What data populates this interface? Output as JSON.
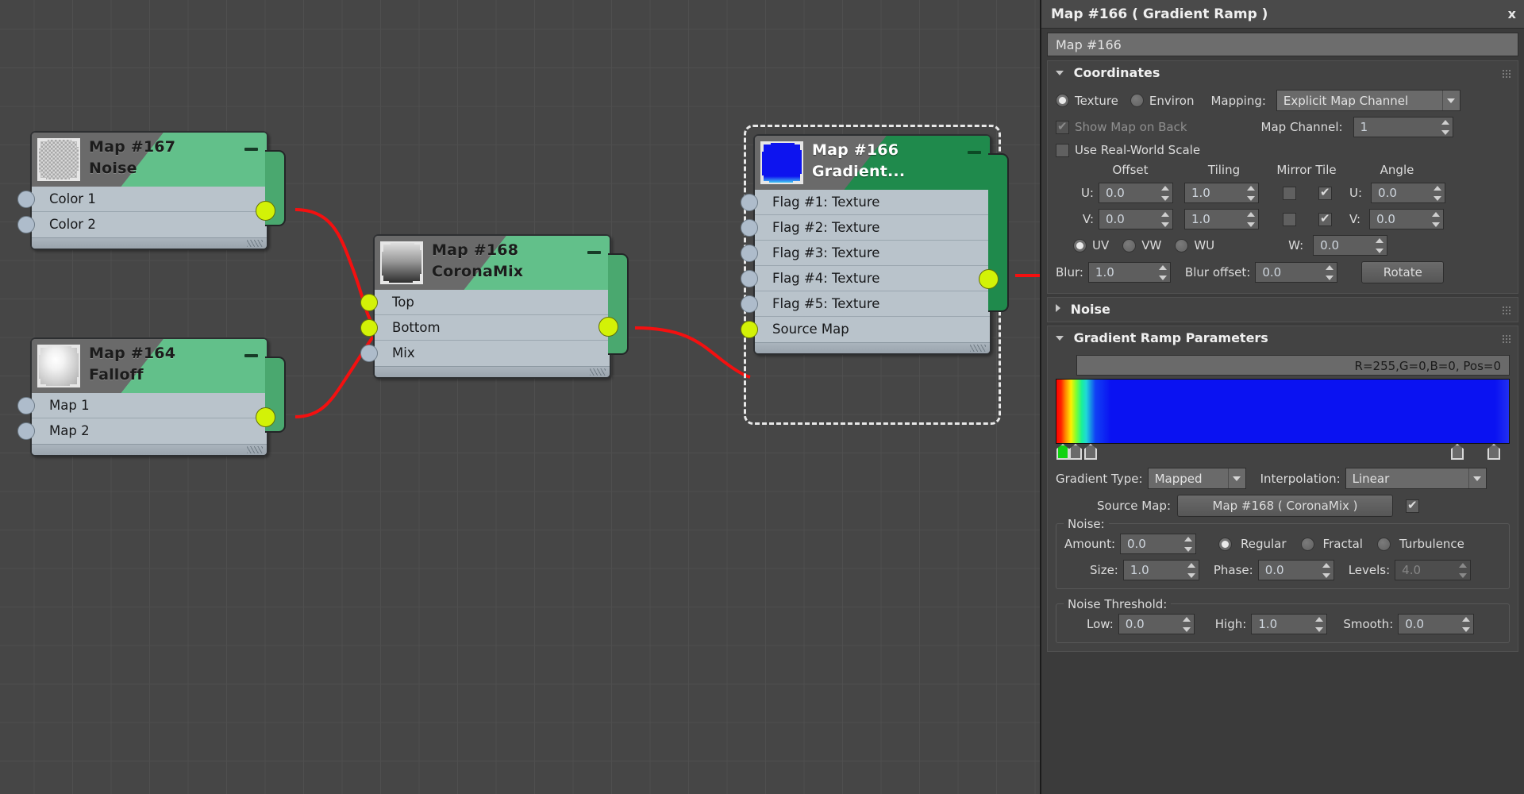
{
  "graph": {
    "nodes": [
      {
        "id": "noise",
        "map_id": "Map #167",
        "type": "Noise",
        "thumb": "noise-thumbnail",
        "selected": false,
        "ports": [
          {
            "label": "Color 1",
            "connected": false
          },
          {
            "label": "Color 2",
            "connected": false
          }
        ],
        "output_connected": true
      },
      {
        "id": "falloff",
        "map_id": "Map #164",
        "type": "Falloff",
        "thumb": "falloff-thumbnail",
        "selected": false,
        "ports": [
          {
            "label": "Map 1",
            "connected": false
          },
          {
            "label": "Map 2",
            "connected": false
          }
        ],
        "output_connected": true
      },
      {
        "id": "coronamix",
        "map_id": "Map #168",
        "type": "CoronaMix",
        "thumb": "coronamix-thumbnail",
        "selected": false,
        "ports": [
          {
            "label": "Top",
            "connected": true
          },
          {
            "label": "Bottom",
            "connected": true
          },
          {
            "label": "Mix",
            "connected": false
          }
        ],
        "output_connected": true
      },
      {
        "id": "gradient",
        "map_id": "Map #166",
        "type": "Gradient...",
        "thumb": "gradient-ramp-thumbnail",
        "selected": true,
        "ports": [
          {
            "label": "Flag #1: Texture",
            "connected": false
          },
          {
            "label": "Flag #2: Texture",
            "connected": false
          },
          {
            "label": "Flag #3: Texture",
            "connected": false
          },
          {
            "label": "Flag #4: Texture",
            "connected": false
          },
          {
            "label": "Flag #5: Texture",
            "connected": false
          },
          {
            "label": "Source Map",
            "connected": true
          }
        ],
        "output_connected": true
      }
    ],
    "wire_color": "#f41010"
  },
  "panel": {
    "title": "Map #166  ( Gradient Ramp )",
    "close_label": "x",
    "name_value": "Map #166",
    "coordinates": {
      "header": "Coordinates",
      "expanded": true,
      "texture_label": "Texture",
      "texture_selected": true,
      "environ_label": "Environ",
      "environ_selected": false,
      "mapping_label": "Mapping:",
      "mapping_value": "Explicit Map Channel",
      "show_map_on_back_label": "Show Map on Back",
      "show_map_on_back_checked": true,
      "map_channel_label": "Map Channel:",
      "map_channel_value": "1",
      "use_real_world_scale_label": "Use Real-World Scale",
      "use_real_world_scale_checked": false,
      "col_offset": "Offset",
      "col_tiling": "Tiling",
      "col_mirror_tile": "Mirror Tile",
      "col_angle": "Angle",
      "u_label": "U:",
      "v_label": "V:",
      "w_label": "W:",
      "offset_u": "0.0",
      "offset_v": "0.0",
      "tiling_u": "1.0",
      "tiling_v": "1.0",
      "mirror_u_checked": false,
      "mirror_v_checked": false,
      "tile_u_checked": true,
      "tile_v_checked": true,
      "angle_u": "0.0",
      "angle_v": "0.0",
      "angle_w": "0.0",
      "uv_label": "UV",
      "uv_selected": true,
      "vw_label": "VW",
      "vw_selected": false,
      "wu_label": "WU",
      "wu_selected": false,
      "blur_label": "Blur:",
      "blur_value": "1.0",
      "blur_offset_label": "Blur offset:",
      "blur_offset_value": "0.0",
      "rotate_label": "Rotate"
    },
    "noise_rollout": {
      "header": "Noise",
      "expanded": false
    },
    "gradient_ramp": {
      "header": "Gradient Ramp Parameters",
      "expanded": true,
      "readout": "R=255,G=0,B=0, Pos=0",
      "gradient_type_label": "Gradient Type:",
      "gradient_type_value": "Mapped",
      "interpolation_label": "Interpolation:",
      "interpolation_value": "Linear",
      "source_map_label": "Source Map:",
      "source_map_value": "Map #168  ( CoronaMix )",
      "source_map_checked": true,
      "flags": [
        {
          "pos_pct": 0.4,
          "selected": true
        },
        {
          "pos_pct": 3.0,
          "selected": false
        },
        {
          "pos_pct": 6.2,
          "selected": false
        },
        {
          "pos_pct": 90.5,
          "selected": false
        },
        {
          "pos_pct": 99.0,
          "selected": false
        }
      ],
      "noise": {
        "title": "Noise:",
        "amount_label": "Amount:",
        "amount_value": "0.0",
        "regular_label": "Regular",
        "regular_selected": true,
        "fractal_label": "Fractal",
        "fractal_selected": false,
        "turbulence_label": "Turbulence",
        "turbulence_selected": false,
        "size_label": "Size:",
        "size_value": "1.0",
        "phase_label": "Phase:",
        "phase_value": "0.0",
        "levels_label": "Levels:",
        "levels_value": "4.0",
        "levels_enabled": false
      },
      "noise_threshold": {
        "title": "Noise Threshold:",
        "low_label": "Low:",
        "low_value": "0.0",
        "high_label": "High:",
        "high_value": "1.0",
        "smooth_label": "Smooth:",
        "smooth_value": "0.0"
      }
    }
  }
}
